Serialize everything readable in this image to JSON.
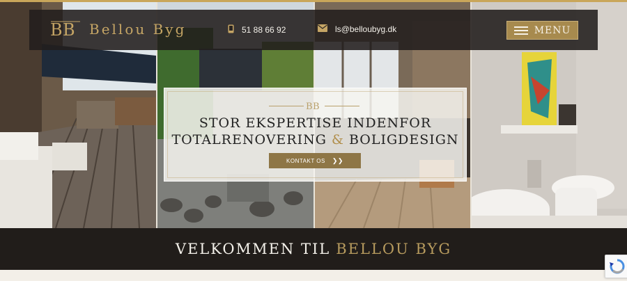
{
  "brand": {
    "name": "Bellou Byg",
    "monogram": "BB"
  },
  "contact": {
    "phone": "51 88 66 92",
    "email": "ls@belloubyg.dk"
  },
  "nav": {
    "menu_label": "MENU"
  },
  "hero": {
    "headline_line1": "Stor ekspertise indenfor",
    "headline_line2_part1": "totalrenovering",
    "headline_amp": "&",
    "headline_line2_part2": "boligdesign",
    "cta_label": "KONTAKT OS"
  },
  "welcome": {
    "part1": "Velkommen til",
    "part2": "Bellou Byg"
  },
  "colors": {
    "gold": "#c5a565",
    "dark": "#211d1a",
    "button": "#a78a4e"
  },
  "icons": {
    "phone": "phone-icon",
    "email": "envelope-icon",
    "menu": "hamburger-icon",
    "cta_arrow": "chevron-right-icon"
  }
}
